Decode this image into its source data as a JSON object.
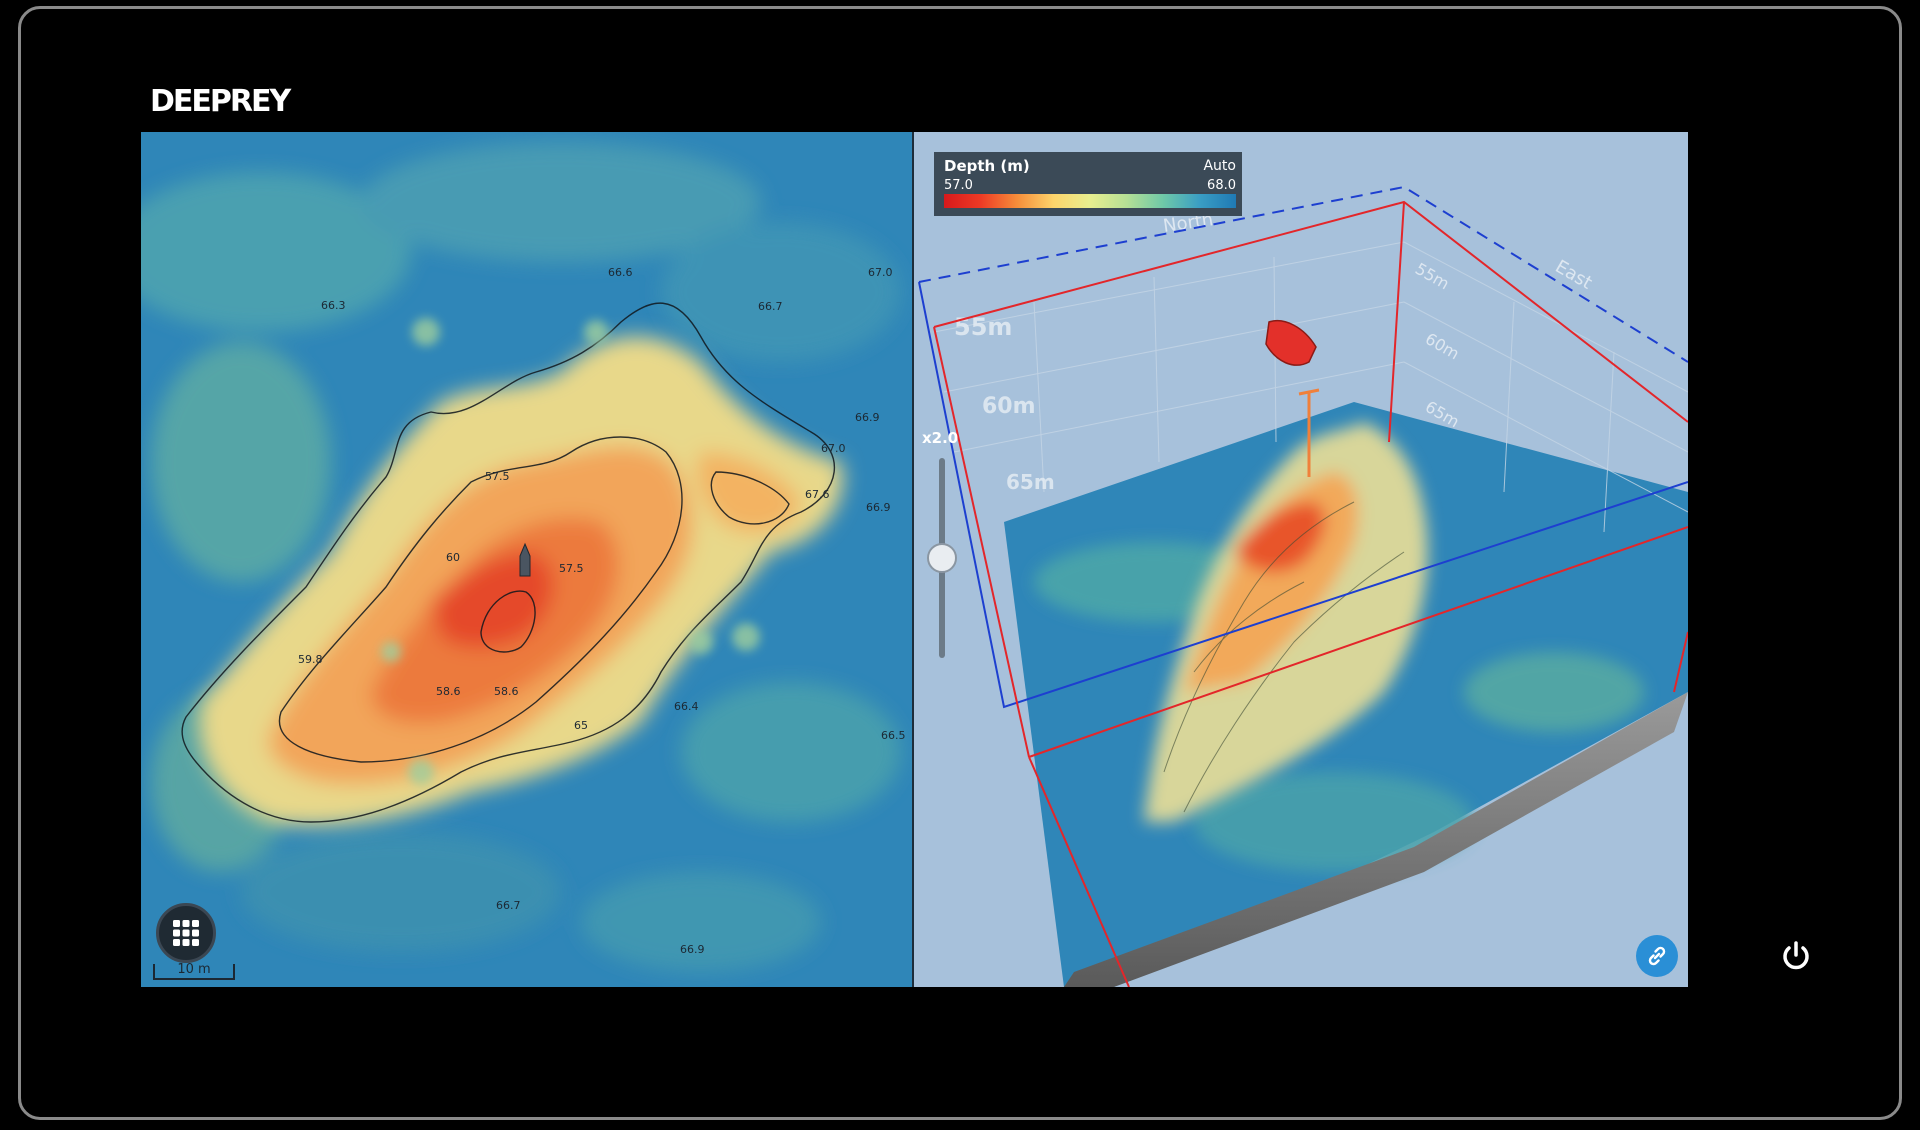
{
  "brand": "DEEPREY",
  "map2d": {
    "depth_labels": [
      {
        "text": "66.3"
      },
      {
        "text": "66.6"
      },
      {
        "text": "67.0"
      },
      {
        "text": "66.7"
      },
      {
        "text": "66.9"
      },
      {
        "text": "67.0"
      },
      {
        "text": "57.5"
      },
      {
        "text": "67.6"
      },
      {
        "text": "66.9"
      },
      {
        "text": "60"
      },
      {
        "text": "57.5"
      },
      {
        "text": "59.8"
      },
      {
        "text": "58.6"
      },
      {
        "text": "58.6"
      },
      {
        "text": "66.4"
      },
      {
        "text": "65"
      },
      {
        "text": "66.5"
      },
      {
        "text": "66.7"
      },
      {
        "text": "66.9"
      }
    ],
    "scale_label": "10 m"
  },
  "view3d": {
    "legend": {
      "title": "Depth (m)",
      "mode": "Auto",
      "min": "57.0",
      "max": "68.0"
    },
    "zoom_label": "x2.0",
    "zoom_level": 0.5,
    "north_label": "North",
    "east_label": "East",
    "depth_marks": [
      "55m",
      "60m",
      "65m"
    ],
    "side_marks": [
      "55m",
      "60m",
      "65m"
    ]
  },
  "colors": {
    "shallow": "#d7191c",
    "deep": "#1f7ab5",
    "box_red": "#e3262a",
    "box_blue": "#1d3fd0"
  },
  "icons": {
    "grid": "grid-icon",
    "link": "link-icon",
    "power": "power-icon",
    "boat": "boat-icon"
  }
}
